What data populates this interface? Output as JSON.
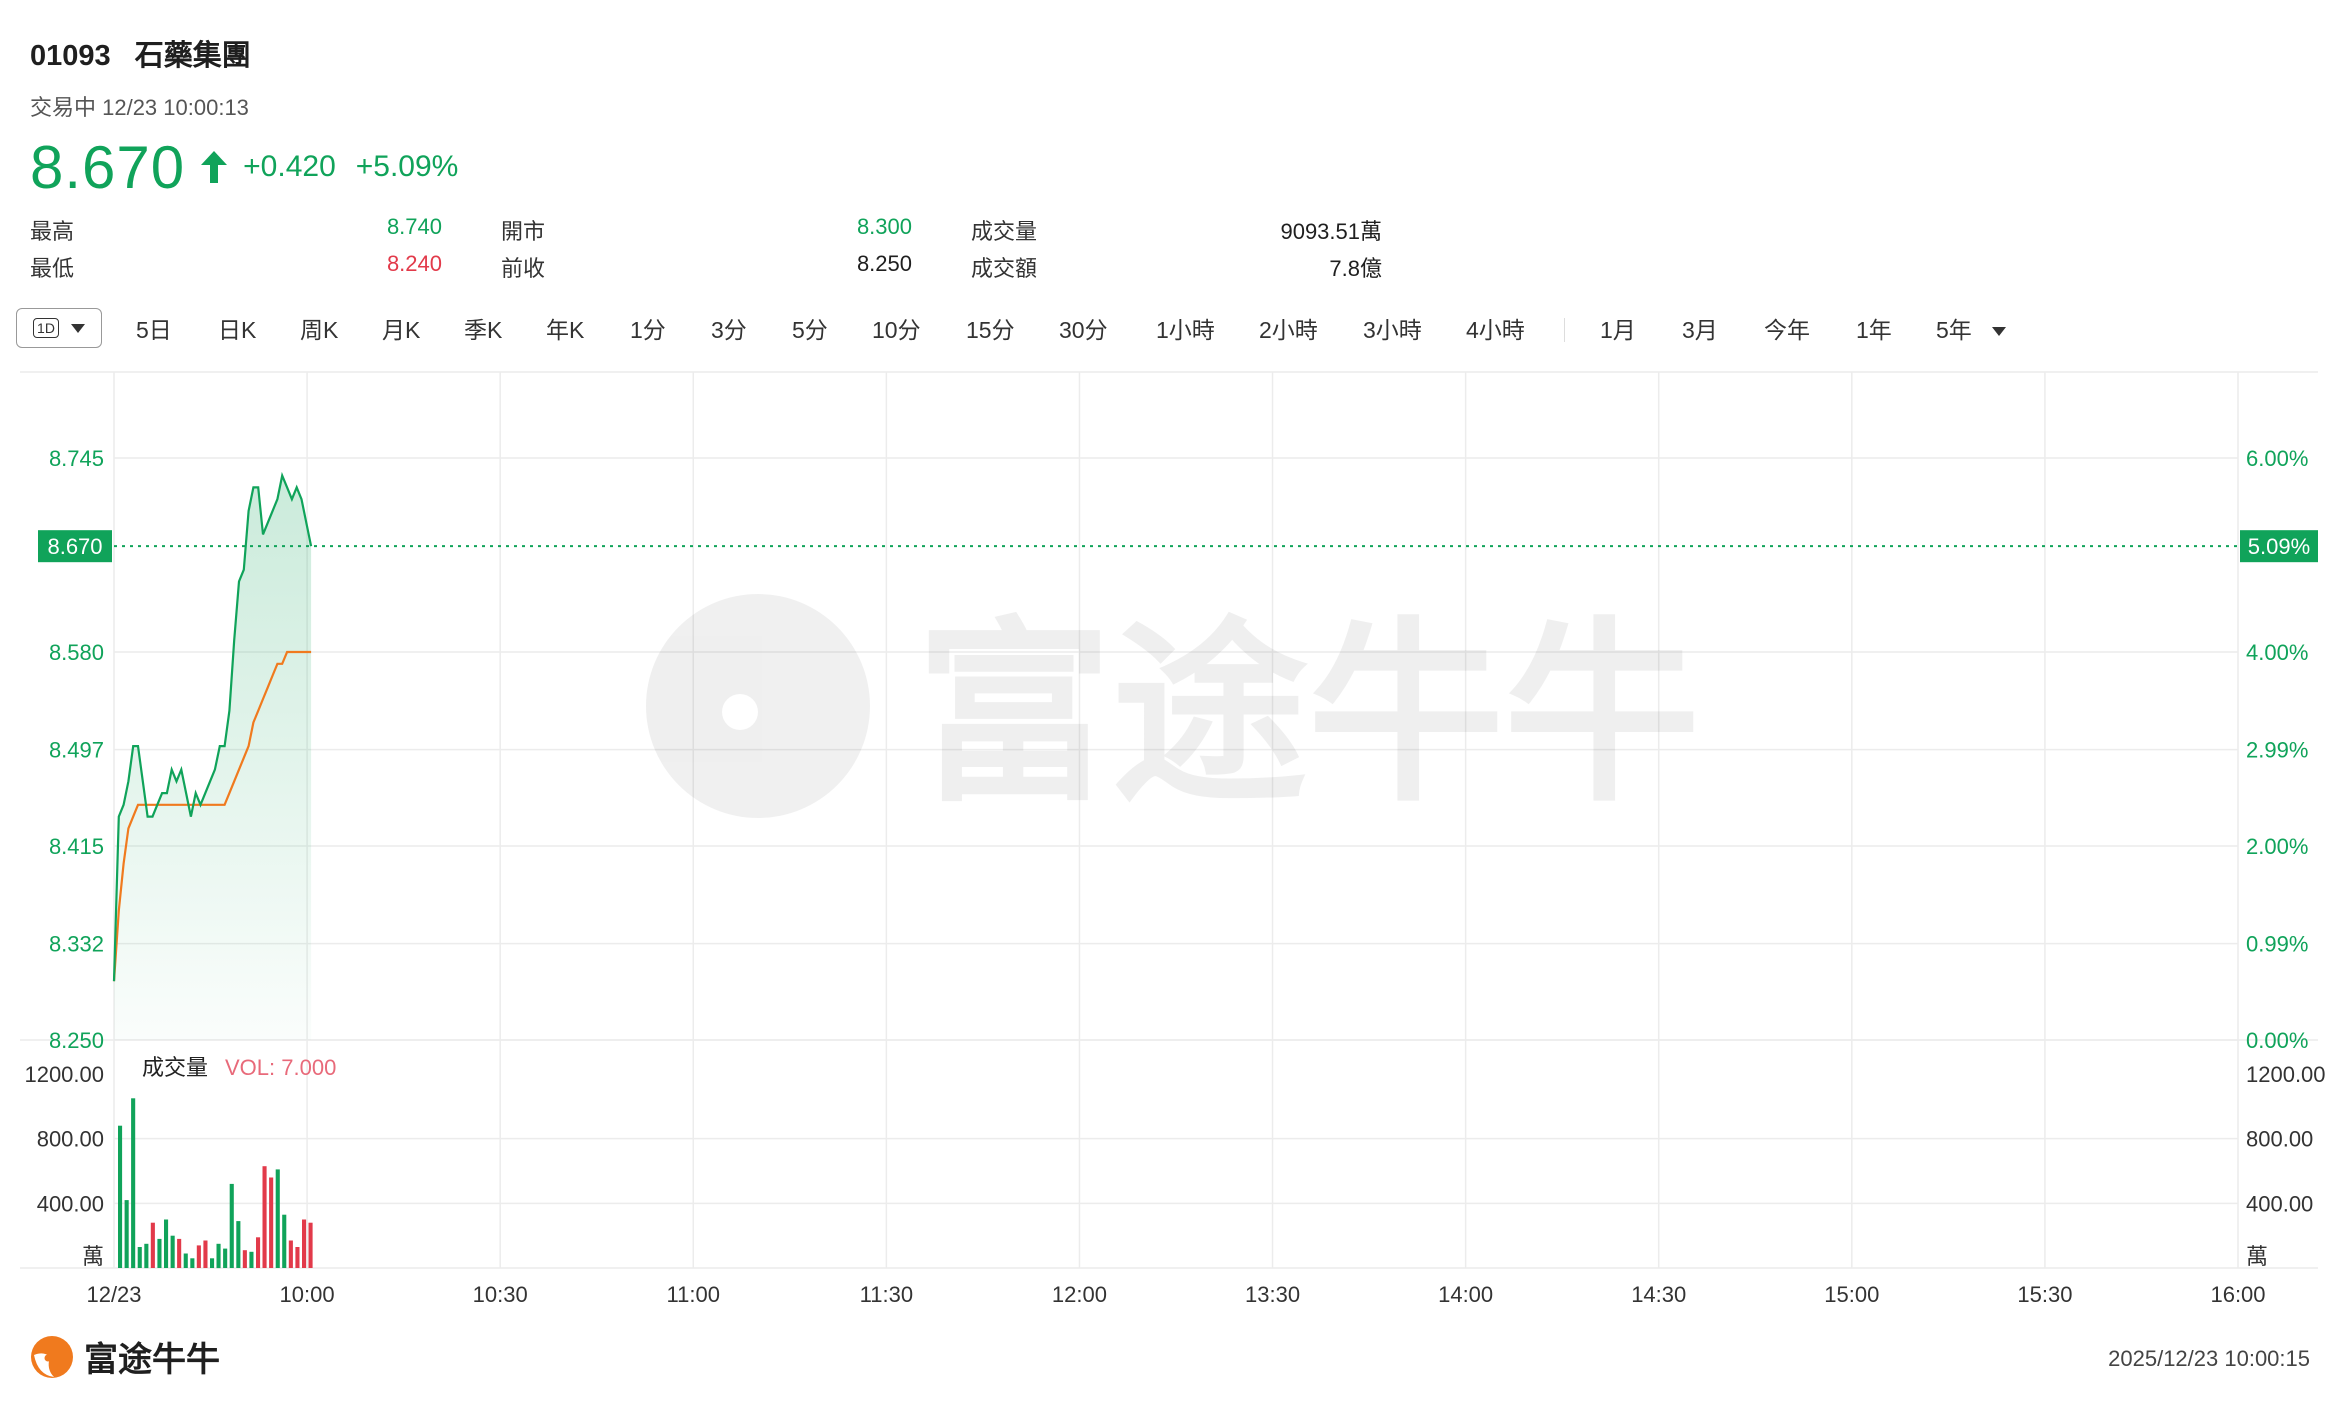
{
  "stock": {
    "code": "01093",
    "name": "石藥集團",
    "status": "交易中 12/23 10:00:13",
    "price": "8.670",
    "change": "+0.420",
    "change_pct": "+5.09%"
  },
  "stats": {
    "high_label": "最高",
    "high": "8.740",
    "low_label": "最低",
    "low": "8.240",
    "open_label": "開市",
    "open": "8.300",
    "prev_close_label": "前收",
    "prev_close": "8.250",
    "volume_label": "成交量",
    "volume": "9093.51萬",
    "turnover_label": "成交額",
    "turnover": "7.8億"
  },
  "tabs": {
    "active": "1D",
    "items": [
      "5日",
      "日K",
      "周K",
      "月K",
      "季K",
      "年K",
      "1分",
      "3分",
      "5分",
      "10分",
      "15分",
      "30分",
      "1小時",
      "2小時",
      "3小時",
      "4小時"
    ],
    "range_items": [
      "1月",
      "3月",
      "今年",
      "1年",
      "5年"
    ]
  },
  "colors": {
    "up": "#10a35a",
    "down": "#e23a4a",
    "avg": "#f07a1e",
    "grid": "#ececec"
  },
  "chart_data": {
    "type": "line",
    "x_ticks": [
      "12/23",
      "10:00",
      "10:30",
      "11:00",
      "11:30",
      "12:00",
      "13:30",
      "14:00",
      "14:30",
      "15:00",
      "15:30",
      "16:00"
    ],
    "y_ticks_left": [
      "8.745",
      "8.670",
      "8.580",
      "8.497",
      "8.415",
      "8.332",
      "8.250"
    ],
    "y_ticks_right": [
      "6.00%",
      "5.09%",
      "4.00%",
      "2.99%",
      "2.00%",
      "0.99%",
      "0.00%"
    ],
    "ylim": [
      8.25,
      8.745
    ],
    "prev_close": 8.25,
    "last_price": "8.670",
    "last_pct": "5.09%",
    "price_series": [
      8.3,
      8.44,
      8.45,
      8.47,
      8.5,
      8.5,
      8.47,
      8.44,
      8.44,
      8.45,
      8.46,
      8.46,
      8.48,
      8.47,
      8.48,
      8.46,
      8.44,
      8.46,
      8.45,
      8.46,
      8.47,
      8.48,
      8.5,
      8.5,
      8.53,
      8.59,
      8.64,
      8.65,
      8.7,
      8.72,
      8.72,
      8.68,
      8.69,
      8.7,
      8.71,
      8.73,
      8.72,
      8.71,
      8.72,
      8.71,
      8.69,
      8.67
    ],
    "avg_series": [
      8.3,
      8.36,
      8.4,
      8.43,
      8.44,
      8.45,
      8.45,
      8.45,
      8.45,
      8.45,
      8.45,
      8.45,
      8.45,
      8.45,
      8.45,
      8.45,
      8.45,
      8.45,
      8.45,
      8.45,
      8.45,
      8.45,
      8.45,
      8.45,
      8.46,
      8.47,
      8.48,
      8.49,
      8.5,
      8.52,
      8.53,
      8.54,
      8.55,
      8.56,
      8.57,
      8.57,
      8.58,
      8.58,
      8.58,
      8.58,
      8.58,
      8.58
    ],
    "volume_label": "成交量",
    "volume_readout": "VOL: 7.000",
    "volume_unit": "萬",
    "volume_ticks": [
      "1200.00",
      "800.00",
      "400.00"
    ],
    "volume_ylim": [
      0,
      1200
    ],
    "volume_bars": [
      {
        "v": 880,
        "up": true
      },
      {
        "v": 420,
        "up": true
      },
      {
        "v": 1050,
        "up": true
      },
      {
        "v": 130,
        "up": true
      },
      {
        "v": 150,
        "up": true
      },
      {
        "v": 280,
        "up": false
      },
      {
        "v": 180,
        "up": true
      },
      {
        "v": 300,
        "up": true
      },
      {
        "v": 200,
        "up": true
      },
      {
        "v": 180,
        "up": false
      },
      {
        "v": 90,
        "up": true
      },
      {
        "v": 60,
        "up": true
      },
      {
        "v": 140,
        "up": false
      },
      {
        "v": 170,
        "up": false
      },
      {
        "v": 60,
        "up": true
      },
      {
        "v": 150,
        "up": true
      },
      {
        "v": 120,
        "up": true
      },
      {
        "v": 520,
        "up": true
      },
      {
        "v": 290,
        "up": true
      },
      {
        "v": 110,
        "up": false
      },
      {
        "v": 100,
        "up": true
      },
      {
        "v": 190,
        "up": false
      },
      {
        "v": 630,
        "up": false
      },
      {
        "v": 560,
        "up": false
      },
      {
        "v": 610,
        "up": true
      },
      {
        "v": 330,
        "up": true
      },
      {
        "v": 170,
        "up": false
      },
      {
        "v": 130,
        "up": false
      },
      {
        "v": 300,
        "up": false
      },
      {
        "v": 280,
        "up": false
      }
    ]
  },
  "watermark": "富途牛牛",
  "footer": {
    "brand": "富途牛牛",
    "timestamp": "2025/12/23 10:00:15"
  }
}
